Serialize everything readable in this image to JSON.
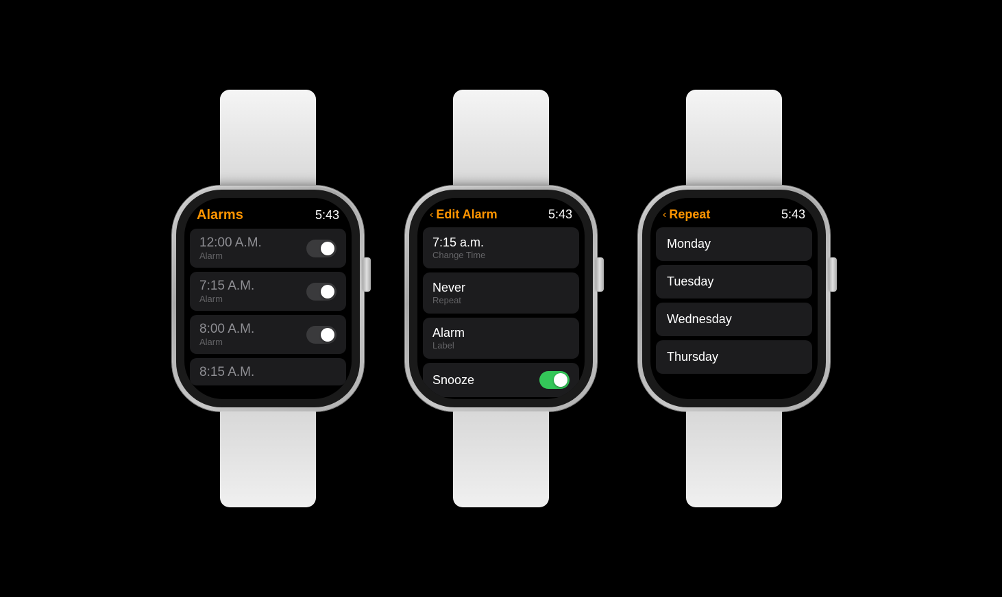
{
  "watch1": {
    "title": "Alarms",
    "time": "5:43",
    "alarms": [
      {
        "time": "12:00 A.M.",
        "label": "Alarm",
        "on": false
      },
      {
        "time": "7:15 A.M.",
        "label": "Alarm",
        "on": false
      },
      {
        "time": "8:00 A.M.",
        "label": "Alarm",
        "on": false
      },
      {
        "time": "8:15 A.M.",
        "label": "",
        "on": false
      }
    ]
  },
  "watch2": {
    "title": "Edit Alarm",
    "back_label": "‹",
    "time": "5:43",
    "items": [
      {
        "main": "7:15 a.m.",
        "sub": "Change Time"
      },
      {
        "main": "Never",
        "sub": "Repeat"
      },
      {
        "main": "Alarm",
        "sub": "Label"
      },
      {
        "main": "Snooze",
        "sub": "",
        "toggle": true,
        "toggle_on": true
      }
    ]
  },
  "watch3": {
    "title": "Repeat",
    "back_label": "‹",
    "time": "5:43",
    "days": [
      "Monday",
      "Tuesday",
      "Wednesday",
      "Thursday"
    ]
  }
}
